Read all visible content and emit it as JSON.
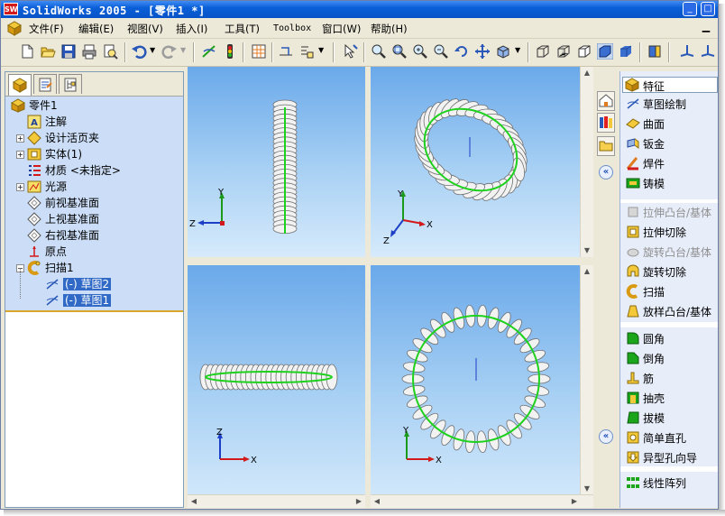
{
  "window": {
    "title": "SolidWorks 2005 - [零件1 *]",
    "app_badge": "SW"
  },
  "title_buttons": [
    "_",
    "□"
  ],
  "menu": {
    "items": [
      "文件(F)",
      "编辑(E)",
      "视图(V)",
      "插入(I)",
      "工具(T)",
      "Toolbox",
      "窗口(W)",
      "帮助(H)"
    ]
  },
  "tree": {
    "root": "零件1",
    "nodes": [
      {
        "label": "注解",
        "icon": "annotation-icon",
        "expand": false
      },
      {
        "label": "设计活页夹",
        "icon": "design-binder-icon",
        "expand": true
      },
      {
        "label": "实体(1)",
        "icon": "solid-body-icon",
        "expand": true
      },
      {
        "label": "材质 <未指定>",
        "icon": "material-icon",
        "expand": false
      },
      {
        "label": "光源",
        "icon": "lighting-icon",
        "expand": true
      },
      {
        "label": "前视基准面",
        "icon": "plane-icon",
        "expand": false
      },
      {
        "label": "上视基准面",
        "icon": "plane-icon",
        "expand": false
      },
      {
        "label": "右视基准面",
        "icon": "plane-icon",
        "expand": false
      },
      {
        "label": "原点",
        "icon": "origin-icon",
        "expand": false
      },
      {
        "label": "扫描1",
        "icon": "sweep-icon",
        "expand": "minus"
      }
    ],
    "children": [
      "(-) 草图2",
      "(-) 草图1"
    ]
  },
  "axes": {
    "x": "X",
    "y": "Y",
    "z": "Z"
  },
  "task_pane": {
    "header": "特征",
    "groups": [
      [
        "草图绘制",
        "曲面",
        "钣金",
        "焊件",
        "铸模"
      ],
      [
        "拉伸凸台/基体",
        "拉伸切除",
        "旋转凸台/基体",
        "旋转切除",
        "扫描",
        "放样凸台/基体"
      ],
      [
        "圆角",
        "倒角",
        "筋",
        "抽壳",
        "拔模",
        "简单直孔",
        "异型孔向导"
      ],
      [
        "线性阵列"
      ]
    ],
    "disabled": [
      "拉伸凸台/基体",
      "旋转凸台/基体"
    ]
  },
  "colors": {
    "title_bar": "#0a5fd8",
    "tree_bg": "#ccdef7",
    "selection": "#3169c6",
    "sweep_path": "#1dd11d"
  }
}
